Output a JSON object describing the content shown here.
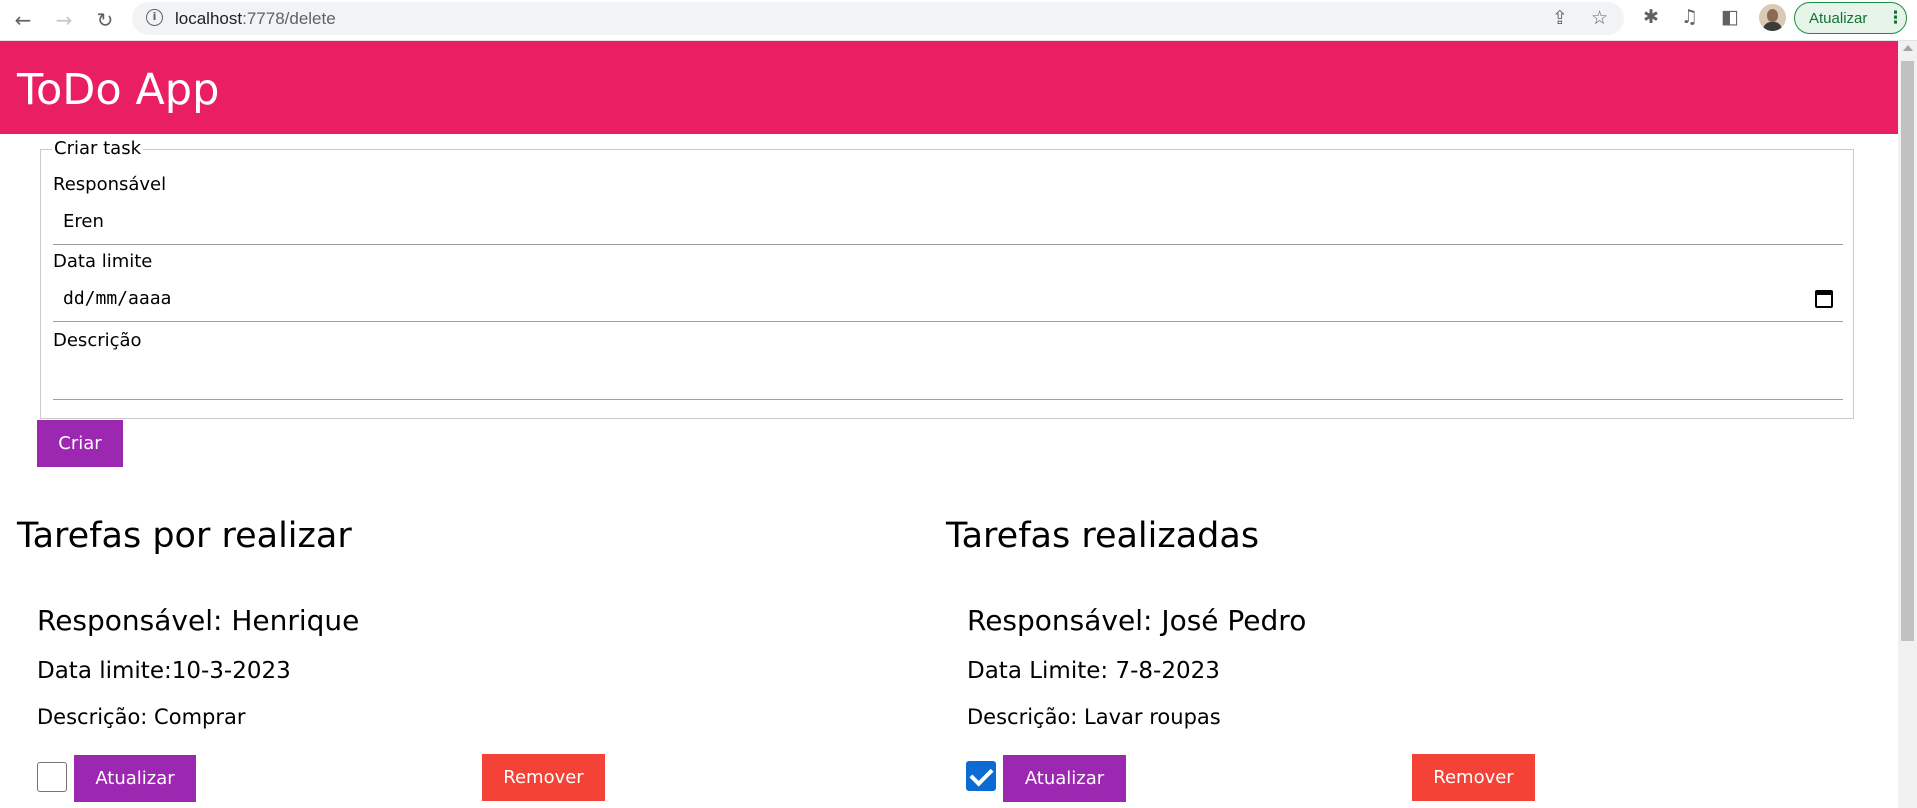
{
  "browser": {
    "url_host": "localhost",
    "url_path": ":7778/delete",
    "update_label": "Atualizar"
  },
  "header": {
    "title": "ToDo App"
  },
  "form": {
    "legend": "Criar task",
    "responsavel_label": "Responsável",
    "responsavel_value": "Eren",
    "data_label": "Data limite",
    "data_placeholder": "dd/mm/aaaa",
    "descricao_label": "Descrição",
    "descricao_value": "",
    "submit_label": "Criar"
  },
  "pending": {
    "title": "Tarefas por realizar",
    "tasks": [
      {
        "responsavel": "Responsável: Henrique",
        "data": "Data limite:10-3-2023",
        "descricao": "Descrição: Comprar",
        "checked": false,
        "update_label": "Atualizar",
        "remove_label": "Remover"
      }
    ]
  },
  "done": {
    "title": "Tarefas realizadas",
    "tasks": [
      {
        "responsavel": "Responsável: José Pedro",
        "data": "Data Limite: 7-8-2023",
        "descricao": "Descrição: Lavar roupas",
        "checked": true,
        "update_label": "Atualizar",
        "remove_label": "Remover"
      }
    ]
  },
  "colors": {
    "header": "#e91e63",
    "primary_button": "#9c27b0",
    "danger_button": "#f44336",
    "checkbox_checked": "#0b6bd3"
  }
}
